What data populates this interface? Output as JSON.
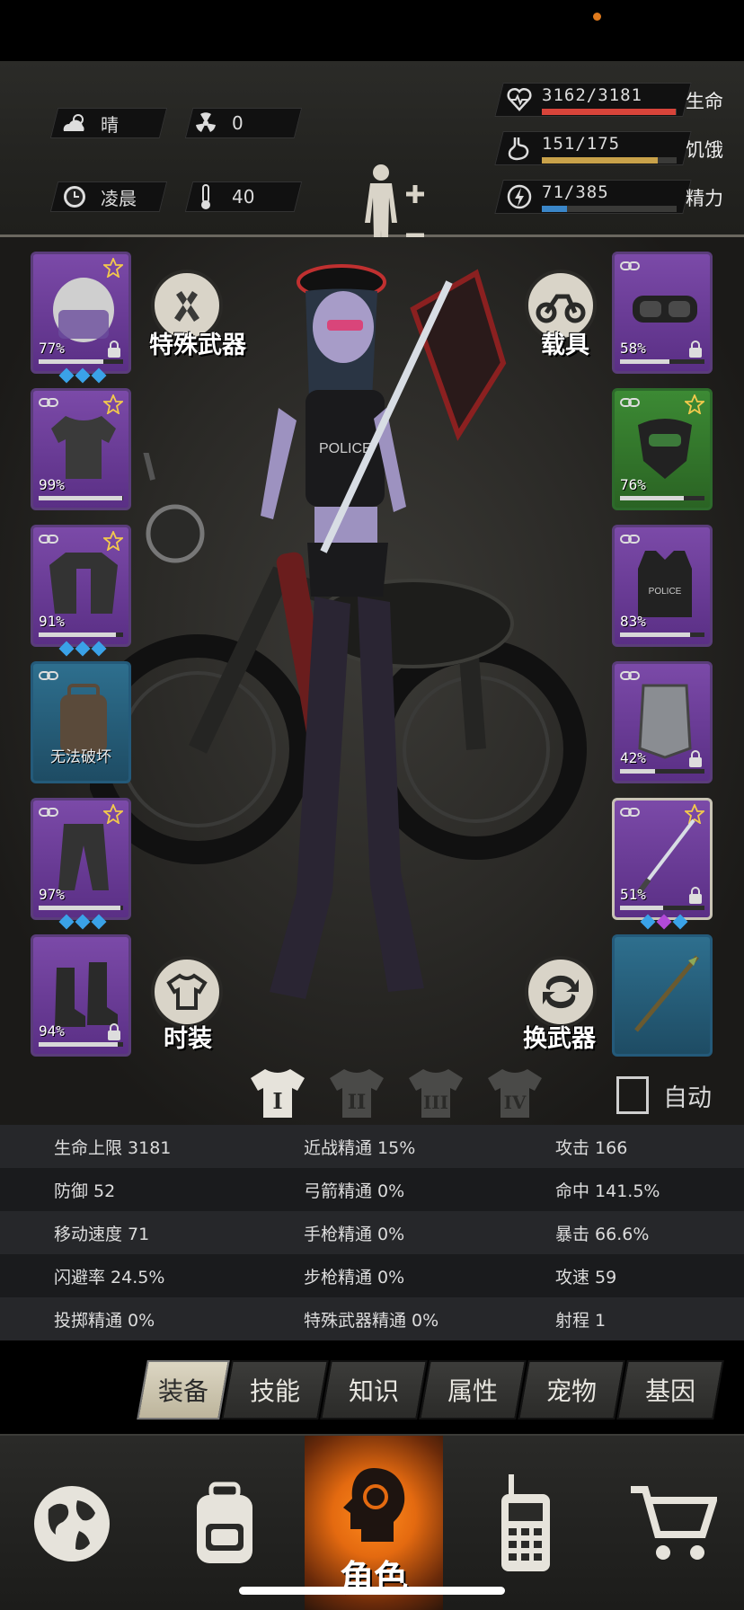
{
  "status": {
    "recording_dot_color": "#e07a1c"
  },
  "hud": {
    "weather": {
      "icon": "cloud-sun-icon",
      "label": "晴"
    },
    "radiation": {
      "icon": "radiation-icon",
      "value": "0"
    },
    "time": {
      "icon": "clock-icon",
      "label": "凌晨"
    },
    "temperature": {
      "icon": "thermometer-icon",
      "value": "40"
    },
    "vitals": [
      {
        "icon": "heart-icon",
        "value": "3162/3181",
        "label": "生命",
        "fraction": 0.994,
        "color": "#d8443a"
      },
      {
        "icon": "stomach-icon",
        "value": "151/175",
        "label": "饥饿",
        "fraction": 0.863,
        "color": "#c9a24a"
      },
      {
        "icon": "energy-icon",
        "value": "71/385",
        "label": "精力",
        "fraction": 0.184,
        "color": "#3a86c8"
      }
    ]
  },
  "equipment": {
    "left": [
      {
        "name": "helmet",
        "percent": "77%",
        "fill": 0.77,
        "rarity": "purple",
        "star": true,
        "lock": true,
        "link": false,
        "gems": [
          "b",
          "b",
          "b"
        ]
      },
      {
        "name": "shirt",
        "percent": "99%",
        "fill": 0.99,
        "rarity": "purple",
        "star": true,
        "lock": false,
        "link": true,
        "gems": []
      },
      {
        "name": "jacket",
        "percent": "91%",
        "fill": 0.91,
        "rarity": "purple",
        "star": true,
        "lock": false,
        "link": true,
        "gems": [
          "b",
          "b",
          "b"
        ]
      },
      {
        "name": "backpack",
        "caption": "无法破坏",
        "rarity": "blue",
        "star": false,
        "lock": false,
        "link": true,
        "gems": []
      },
      {
        "name": "pants",
        "percent": "97%",
        "fill": 0.97,
        "rarity": "purple",
        "star": true,
        "lock": false,
        "link": true,
        "gems": [
          "b",
          "b",
          "b"
        ]
      },
      {
        "name": "boots",
        "percent": "94%",
        "fill": 0.94,
        "rarity": "purple",
        "star": false,
        "lock": true,
        "link": false,
        "gems": []
      }
    ],
    "right": [
      {
        "name": "goggles",
        "percent": "58%",
        "fill": 0.58,
        "rarity": "purple",
        "star": false,
        "lock": true,
        "link": true,
        "gems": []
      },
      {
        "name": "gas-mask",
        "percent": "76%",
        "fill": 0.76,
        "rarity": "green",
        "star": true,
        "lock": false,
        "link": true,
        "gems": []
      },
      {
        "name": "vest",
        "percent": "83%",
        "fill": 0.83,
        "rarity": "purple",
        "star": false,
        "lock": false,
        "link": true,
        "gems": []
      },
      {
        "name": "shield",
        "percent": "42%",
        "fill": 0.42,
        "rarity": "purple",
        "star": false,
        "lock": true,
        "link": true,
        "gems": []
      },
      {
        "name": "katana",
        "percent": "51%",
        "fill": 0.51,
        "rarity": "grey",
        "star": true,
        "lock": true,
        "link": true,
        "gems": [
          "b",
          "p",
          "b"
        ]
      },
      {
        "name": "spear",
        "rarity": "blue",
        "star": false,
        "lock": false,
        "link": false,
        "gems": []
      }
    ]
  },
  "buttons": {
    "special_weapon": "特殊武器",
    "vehicle": "载具",
    "fashion": "时装",
    "swap_weapon": "换武器",
    "auto": "自动"
  },
  "outfit_sets": [
    "I",
    "II",
    "III",
    "IV"
  ],
  "stats": [
    [
      "生命上限 3181",
      "近战精通 15%",
      "攻击 166"
    ],
    [
      "防御 52",
      "弓箭精通 0%",
      "命中 141.5%"
    ],
    [
      "移动速度 71",
      "手枪精通 0%",
      "暴击 66.6%"
    ],
    [
      "闪避率 24.5%",
      "步枪精通 0%",
      "攻速 59"
    ],
    [
      "投掷精通 0%",
      "特殊武器精通 0%",
      "射程 1"
    ]
  ],
  "tabs": [
    "装备",
    "技能",
    "知识",
    "属性",
    "宠物",
    "基因"
  ],
  "nav": {
    "items": [
      "globe-icon",
      "backpack-icon",
      "character-icon",
      "walkie-talkie-icon",
      "cart-icon"
    ],
    "active_label": "角色"
  }
}
